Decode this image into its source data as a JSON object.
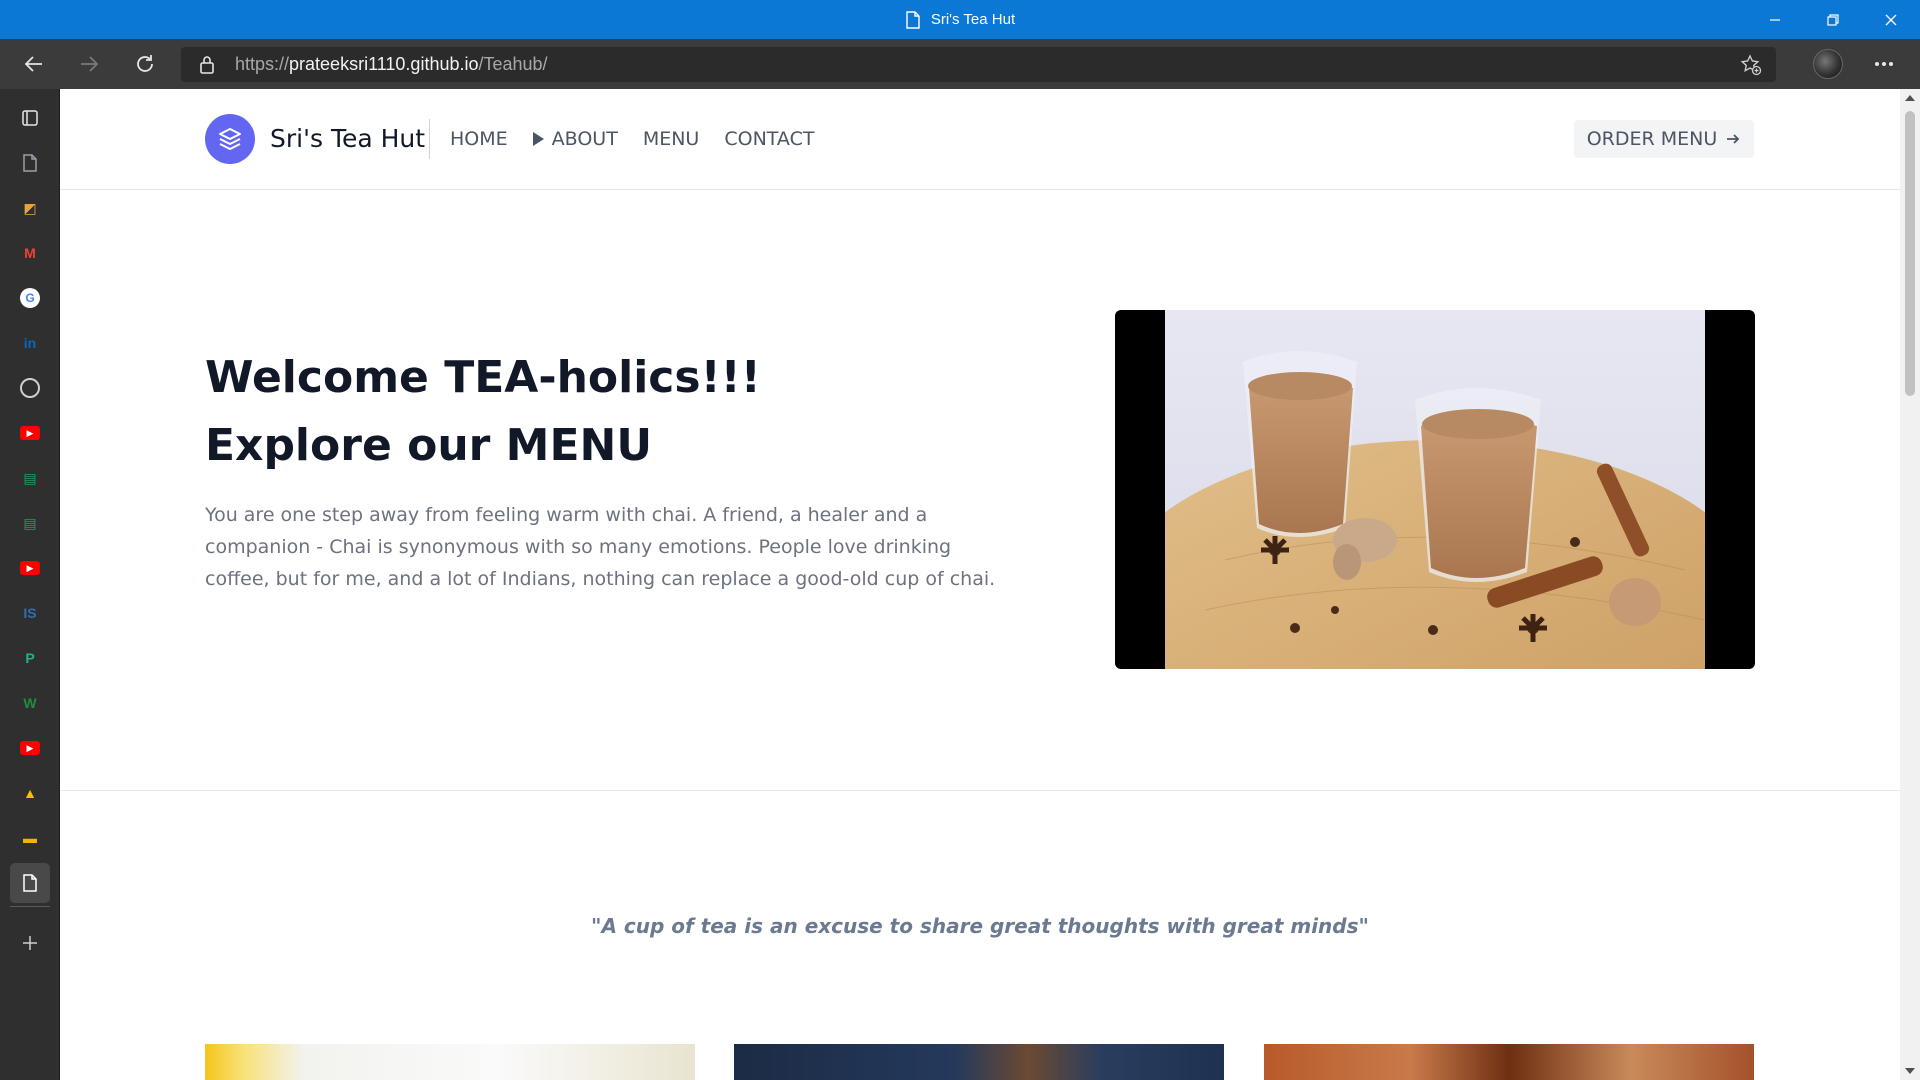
{
  "browser": {
    "window_title": "Sri's Tea Hut",
    "url_scheme": "https://",
    "url_host": "prateeksri1110.github.io",
    "url_path": "/Teahub/"
  },
  "vertical_tabs": [
    {
      "name": "tab-actions-icon",
      "color": "#ffffff"
    },
    {
      "name": "blank-page-icon",
      "color": "#9aa0a6"
    },
    {
      "name": "colorful-site-icon",
      "color": "#e8a33d"
    },
    {
      "name": "gmail-icon",
      "color": "#ea4335"
    },
    {
      "name": "google-icon",
      "color": "#4285f4"
    },
    {
      "name": "linkedin-icon",
      "color": "#0a66c2"
    },
    {
      "name": "github-icon",
      "color": "#cfcfcf"
    },
    {
      "name": "youtube-icon",
      "color": "#ff0000"
    },
    {
      "name": "green-site-icon",
      "color": "#1aa260"
    },
    {
      "name": "green-site-icon",
      "color": "#1aa260"
    },
    {
      "name": "youtube-icon",
      "color": "#ff0000"
    },
    {
      "name": "is-site-icon",
      "color": "#2d6fb0"
    },
    {
      "name": "teal-site-icon",
      "color": "#20b08a"
    },
    {
      "name": "w-site-icon",
      "color": "#1e8e3e"
    },
    {
      "name": "youtube-icon",
      "color": "#ff0000"
    },
    {
      "name": "google-drive-icon",
      "color": "#fbbc04"
    },
    {
      "name": "google-slides-icon",
      "color": "#f4b400"
    },
    {
      "name": "current-page-icon",
      "color": "#ffffff"
    }
  ],
  "site": {
    "brand": "Sri's Tea Hut",
    "nav": [
      {
        "label": "HOME",
        "has_marker": false
      },
      {
        "label": "ABOUT",
        "has_marker": true
      },
      {
        "label": "MENU",
        "has_marker": false
      },
      {
        "label": "CONTACT",
        "has_marker": false
      }
    ],
    "order_button": "ORDER MENU"
  },
  "hero": {
    "title_line1": "Welcome TEA-holics!!!",
    "title_line2": "Explore our MENU",
    "text": "You are one step away from feeling warm with chai. A friend, a healer and a companion - Chai is synonymous with so many emotions. People love drinking coffee, but for me, and a lot of Indians, nothing can replace a good-old cup of chai."
  },
  "quote": "\"A cup of tea is an excuse to share great thoughts with great minds\"",
  "colors": {
    "titlebar": "#0a78d4",
    "brand_accent": "#6366f1",
    "heading": "#111827",
    "body_text": "#6b7280"
  }
}
